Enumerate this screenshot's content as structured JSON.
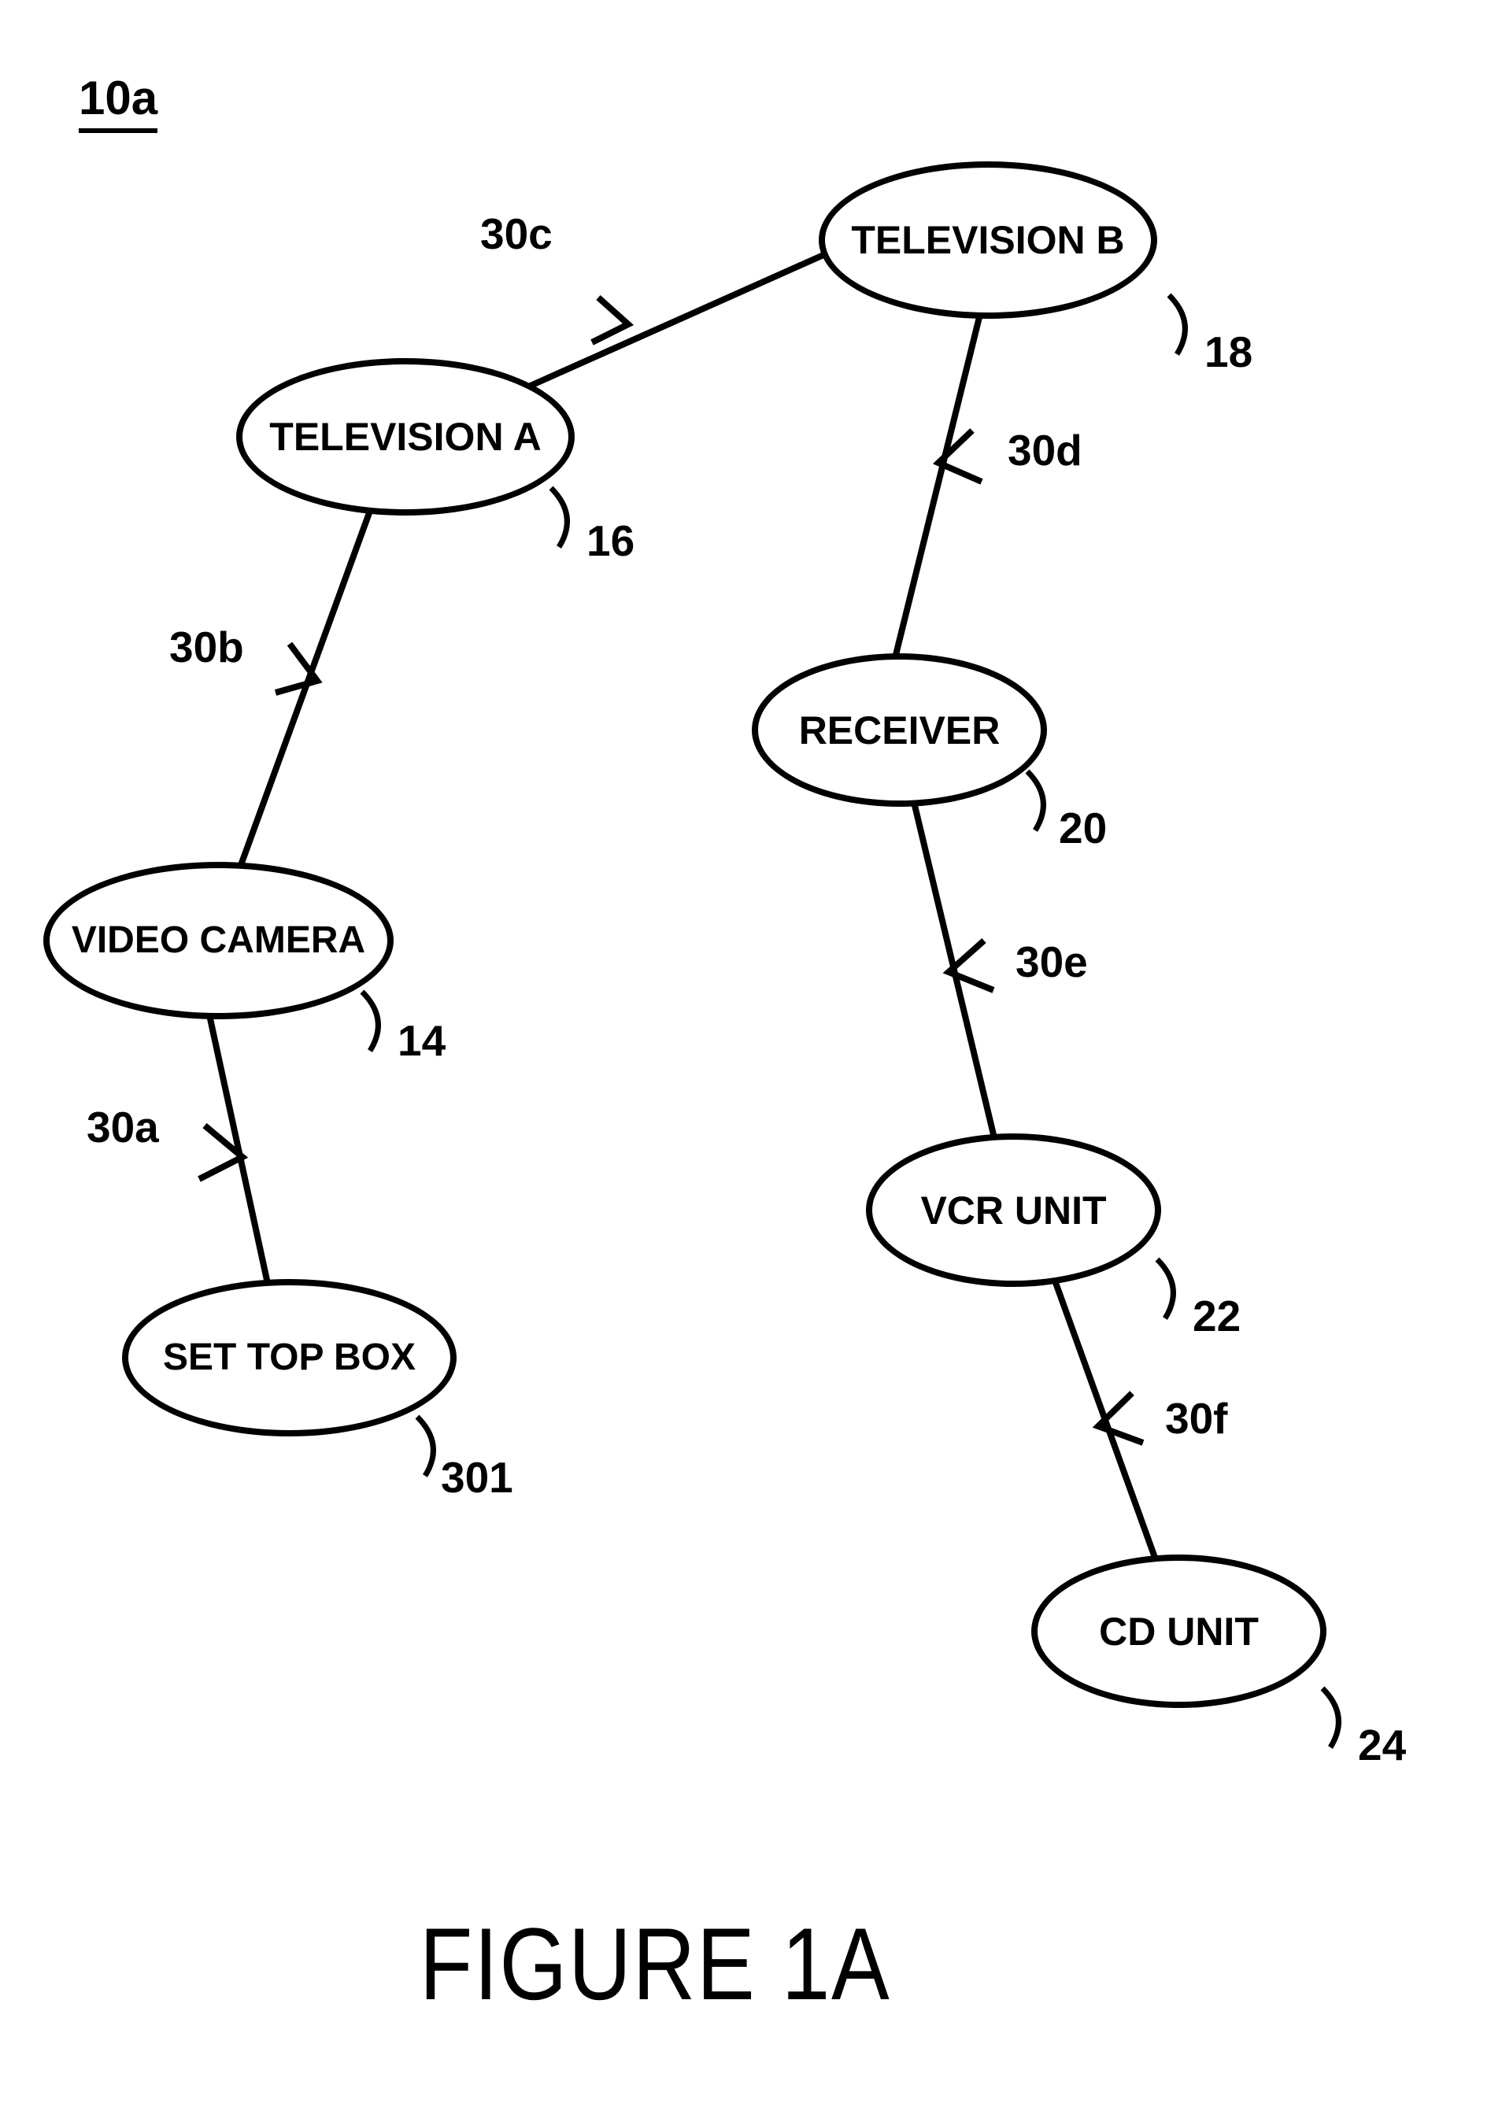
{
  "figure_id": "10a",
  "figure_caption": "FIGURE 1A",
  "nodes": {
    "television_b": {
      "text": "TELEVISION B",
      "ref": "18"
    },
    "television_a": {
      "text": "TELEVISION A",
      "ref": "16"
    },
    "receiver": {
      "text": "RECEIVER",
      "ref": "20"
    },
    "video_camera": {
      "text": "VIDEO CAMERA",
      "ref": "14"
    },
    "vcr_unit": {
      "text": "VCR UNIT",
      "ref": "22"
    },
    "set_top_box": {
      "text": "SET TOP BOX",
      "ref": "301"
    },
    "cd_unit": {
      "text": "CD UNIT",
      "ref": "24"
    }
  },
  "edges": {
    "e30a": "30a",
    "e30b": "30b",
    "e30c": "30c",
    "e30d": "30d",
    "e30e": "30e",
    "e30f": "30f"
  }
}
